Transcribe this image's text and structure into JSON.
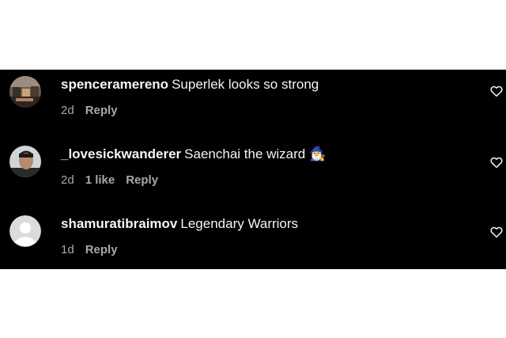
{
  "comments": [
    {
      "username": "spenceramereno",
      "text": "Superlek looks so strong",
      "time": "2d",
      "likes": "",
      "reply": "Reply",
      "avatar": "photo-avatar"
    },
    {
      "username": "_lovesickwanderer",
      "text": "Saenchai the wizard 🧙‍♂️",
      "time": "2d",
      "likes": "1 like",
      "reply": "Reply",
      "avatar": "photo-avatar"
    },
    {
      "username": "shamuratibraimov",
      "text": "Legendary Warriors",
      "time": "1d",
      "likes": "",
      "reply": "Reply",
      "avatar": "default-avatar"
    }
  ],
  "colors": {
    "background": "#000000",
    "primary_text": "#f5f5f5",
    "secondary_text": "#a8a8a8"
  },
  "icons": {
    "like": "heart-outline-icon"
  }
}
